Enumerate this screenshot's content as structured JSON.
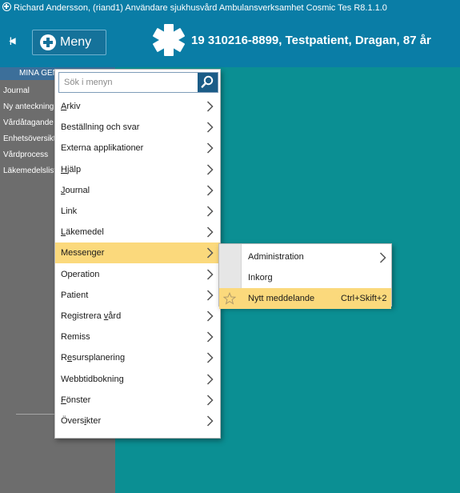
{
  "window": {
    "title": "Richard  Andersson, (riand1) Användare sjukhusvård Ambulansverksamhet  Cosmic Tes R8.1.1.0"
  },
  "header": {
    "menu_label": "Meny",
    "patient_info": "19 310216-8899,  Testpatient, Dragan,  87 år"
  },
  "sidebar": {
    "heading": "MINA GEN",
    "items": [
      "Journal",
      "Ny anteckning",
      "Vårdåtagande",
      "Enhetsöversikt",
      "Vårdprocess",
      "Läkemedelslista"
    ]
  },
  "menu": {
    "search_placeholder": "Sök i menyn",
    "items": [
      {
        "label": "Arkiv"
      },
      {
        "label": "Beställning och svar"
      },
      {
        "label": "Externa applikationer"
      },
      {
        "label": "Hjälp"
      },
      {
        "label": "Journal"
      },
      {
        "label": "Link"
      },
      {
        "label": "Läkemedel"
      },
      {
        "label": "Messenger",
        "active": true
      },
      {
        "label": "Operation"
      },
      {
        "label": "Patient"
      },
      {
        "label": "Registrera vård"
      },
      {
        "label": "Remiss"
      },
      {
        "label": "Resursplanering"
      },
      {
        "label": "Webbtidbokning"
      },
      {
        "label": "Fönster"
      },
      {
        "label": "Översikter"
      }
    ]
  },
  "submenu": {
    "items": [
      {
        "label": "Administration",
        "has_submenu": true
      },
      {
        "label": "Inkorg"
      },
      {
        "label": "Nytt meddelande",
        "shortcut": "Ctrl+Skift+2",
        "active": true
      }
    ]
  },
  "colors": {
    "header_bg": "#0a7da6",
    "content_bg": "#0b8f93",
    "sidebar_bg": "#6d6d6d",
    "highlight": "#fbd97c",
    "search_button": "#1b5c87"
  }
}
